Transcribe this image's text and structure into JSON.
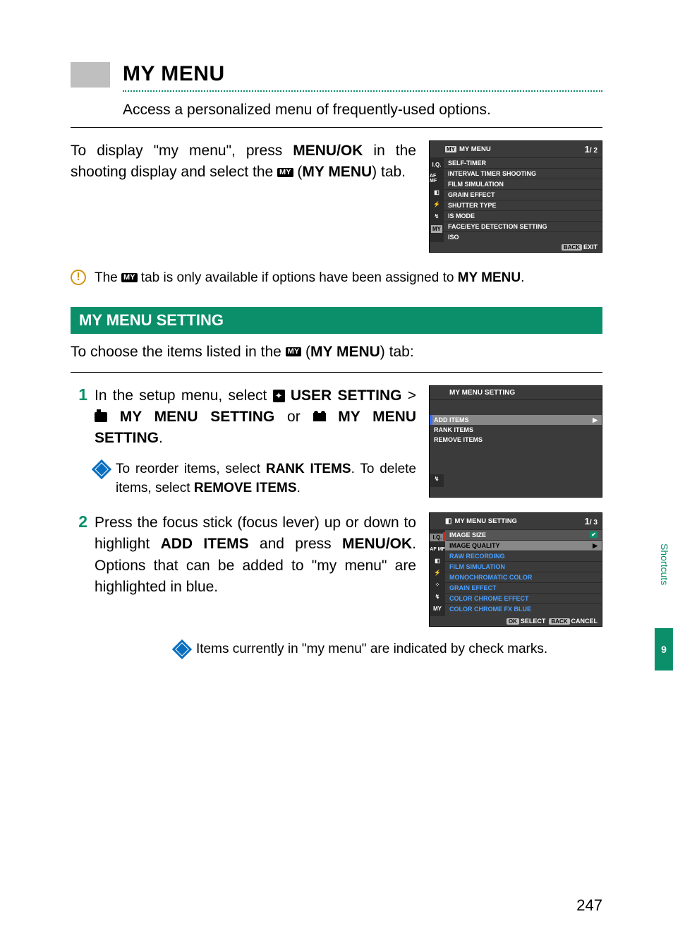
{
  "title": "MY MENU",
  "subtitle": "Access a personalized menu of frequently-used options.",
  "intro_1": "To display \"my menu\", press ",
  "intro_menu_ok": "MENU/OK",
  "intro_2": " in the shooting display and select the ",
  "intro_3": " (",
  "intro_my_menu": "MY MENU",
  "intro_4": ") tab.",
  "screenshot1": {
    "title": "MY MENU",
    "page": "1",
    "page_total": "/ 2",
    "items": [
      "SELF-TIMER",
      "INTERVAL TIMER SHOOTING",
      "FILM SIMULATION",
      "GRAIN EFFECT",
      "SHUTTER TYPE",
      "IS MODE",
      "FACE/EYE DETECTION SETTING",
      "ISO"
    ],
    "back": "BACK",
    "exit": "EXIT",
    "tabs": {
      "iq": "I.Q.",
      "af": "AF\nMF",
      "my": "MY"
    }
  },
  "warn_1": "The ",
  "warn_2": " tab is only available if options have been assigned to ",
  "warn_my": "MY MENU",
  "warn_3": ".",
  "section_header": "MY MENU SETTING",
  "choose_1": "To choose the items listed in the ",
  "choose_2": " (",
  "choose_my": "MY MENU",
  "choose_3": ") tab:",
  "step1_a": "In the setup menu, select ",
  "step1_user": "USER SETTING",
  "step1_gt": " > ",
  "step1_mms": " MY MENU SETTING",
  "step1_or": " or ",
  "step1_mms2": " MY MENU SETTING",
  "step1_dot": ".",
  "tip1_a": "To reorder items, select ",
  "tip1_rank": "RANK ITEMS",
  "tip1_b": ". To delete items, select ",
  "tip1_remove": "REMOVE ITEMS",
  "tip1_c": ".",
  "screenshot2": {
    "title": "MY MENU SETTING",
    "items": [
      "ADD ITEMS",
      "RANK ITEMS",
      "REMOVE ITEMS"
    ]
  },
  "step2_a": "Press the focus stick (focus lever) up or down to highlight ",
  "step2_add": "ADD ITEMS",
  "step2_b": " and press ",
  "step2_menu": "MENU/OK",
  "step2_c": ". Options that can be added to \"my menu\" are highlighted in blue.",
  "screenshot3": {
    "title": "MY MENU SETTING",
    "page": "1",
    "page_total": "/ 3",
    "items": [
      "IMAGE SIZE",
      "IMAGE QUALITY",
      "RAW RECORDING",
      "FILM SIMULATION",
      "MONOCHROMATIC COLOR",
      "GRAIN EFFECT",
      "COLOR CHROME EFFECT",
      "COLOR CHROME FX BLUE"
    ],
    "ok": "OK",
    "select": "SELECT",
    "back": "BACK",
    "cancel": "CANCEL",
    "tabs": {
      "iq": "I.Q.",
      "af": "AF\nMF",
      "my": "MY"
    }
  },
  "tip2": "Items currently in \"my menu\" are indicated by check marks.",
  "side_label": "Shortcuts",
  "side_num": "9",
  "page_number": "247"
}
